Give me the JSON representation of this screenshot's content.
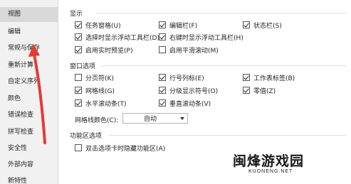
{
  "sidebar": {
    "items": [
      {
        "label": "视图",
        "active": true
      },
      {
        "label": "编辑"
      },
      {
        "label": "常规与保存"
      },
      {
        "label": "重新计算"
      },
      {
        "label": "自定义序列"
      },
      {
        "label": "颜色"
      },
      {
        "label": "错误检查"
      },
      {
        "label": "拼写检查"
      },
      {
        "label": "安全性"
      },
      {
        "label": "外部内容"
      },
      {
        "label": "新特性"
      }
    ]
  },
  "display": {
    "title": "显示",
    "options": [
      {
        "label": "任务窗格(U)",
        "checked": true
      },
      {
        "label": "编辑栏(F)",
        "checked": true
      },
      {
        "label": "状态栏(S)",
        "checked": true
      },
      {
        "label": "选择时显示浮动工具栏(D)",
        "checked": true
      },
      {
        "label": "右键时显示浮动工具栏(H)",
        "checked": true
      },
      {
        "label": "启用实时预览(P)",
        "checked": true
      },
      {
        "label": "启用平滑滚动(M)",
        "checked": false
      }
    ]
  },
  "window": {
    "title": "窗口选项",
    "options": [
      {
        "label": "分页符(K)",
        "checked": false
      },
      {
        "label": "行号列标(E)",
        "checked": true
      },
      {
        "label": "工作表标签(B)",
        "checked": true
      },
      {
        "label": "网格线(G)",
        "checked": true
      },
      {
        "label": "分级显示符号(O)",
        "checked": true
      },
      {
        "label": "零值(Z)",
        "checked": true
      },
      {
        "label": "水平滚动条(T)",
        "checked": true
      },
      {
        "label": "垂直滚动条(V)",
        "checked": true
      }
    ],
    "gridline_color_label": "网格线颜色(C):",
    "gridline_color_value": "自动"
  },
  "ribbon": {
    "title": "功能区选项",
    "options": [
      {
        "label": "双击选项卡时隐藏功能区(A)",
        "checked": false
      }
    ]
  },
  "watermark": {
    "main": "闽烽游戏园",
    "sub": "KUONENG.NET"
  },
  "colors": {
    "annotation_arrow": "#e53935"
  }
}
